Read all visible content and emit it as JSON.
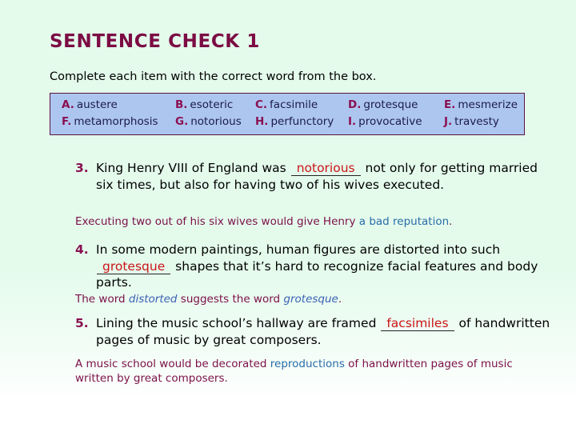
{
  "slide": {
    "title": "SENTENCE CHECK 1",
    "instruction": "Complete each item with the correct word from the box.",
    "background_color": "#e4fbec",
    "title_color": "#7c0c44"
  },
  "wordbox": {
    "background_color": "#adc6f0",
    "border_color": "#5c1240",
    "letter_color": "#8a1050",
    "word_color": "#1b1b4a",
    "rows": [
      [
        {
          "letter": "A.",
          "word": "austere"
        },
        {
          "letter": "B.",
          "word": "esoteric"
        },
        {
          "letter": "C.",
          "word": "facsimile"
        },
        {
          "letter": "D.",
          "word": "grotesque"
        },
        {
          "letter": "E.",
          "word": "mesmerize"
        }
      ],
      [
        {
          "letter": "F.",
          "word": "metamorphosis"
        },
        {
          "letter": "G.",
          "word": "notorious"
        },
        {
          "letter": "H.",
          "word": "perfunctory"
        },
        {
          "letter": "I.",
          "word": "provocative"
        },
        {
          "letter": "J.",
          "word": "travesty"
        }
      ]
    ]
  },
  "items": [
    {
      "number": "3.",
      "text_before": "King Henry VIII of England was ",
      "answer": "notorious",
      "text_after": " not only for getting married six times, but also for having two of his wives executed.",
      "answer_color": "#cc1417"
    },
    {
      "number": "4.",
      "text_before": "In some modern paintings, human figures are distorted into such ",
      "answer": "grotesque",
      "text_after": " shapes that it’s hard to recognize facial features and body parts.",
      "answer_color": "#cc1417"
    },
    {
      "number": "5.",
      "text_before": "Lining the music school’s hallway are framed ",
      "answer": "facsimiles",
      "text_after": " of handwritten pages of music by great composers.",
      "answer_color": "#cc1417"
    }
  ],
  "explanations": [
    {
      "part1": "Executing two out of his six wives would give Henry ",
      "highlight": "a bad reputation",
      "part2": ".",
      "highlight_color": "#2a6ca8"
    },
    {
      "part1": "The word ",
      "italic1": "distorted",
      "part2": " suggests the word ",
      "italic2": "grotesque",
      "part3": ".",
      "highlight_color": "#3a62b5"
    },
    {
      "part1": "A music school would be decorated ",
      "highlight": "reproductions",
      "part2": " of handwritten pages of music written by great composers.",
      "highlight_color": "#2a6ca8"
    }
  ]
}
